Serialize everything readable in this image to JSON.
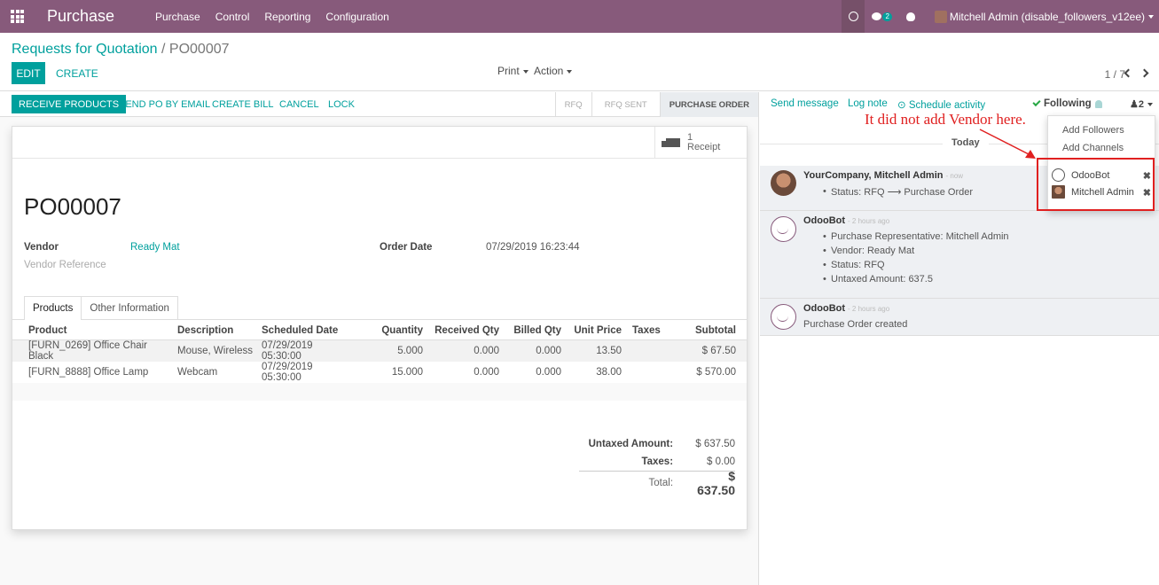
{
  "navbar": {
    "app_title": "Purchase",
    "menu": [
      "Purchase",
      "Control",
      "Reporting",
      "Configuration"
    ],
    "messages_count": "2",
    "user_name": "Mitchell Admin (disable_followers_v12ee)"
  },
  "breadcrumb": {
    "parent": "Requests for Quotation",
    "separator": "/",
    "current": "PO00007"
  },
  "control": {
    "edit": "EDIT",
    "create": "CREATE",
    "print": "Print",
    "action": "Action",
    "pager": "1 / 7"
  },
  "header_buttons": [
    "RECEIVE PRODUCTS",
    "SEND PO BY EMAIL",
    "CREATE BILL",
    "CANCEL",
    "LOCK"
  ],
  "stages": [
    "RFQ",
    "RFQ SENT",
    "PURCHASE ORDER"
  ],
  "active_stage": "PURCHASE ORDER",
  "receipt": {
    "count": "1",
    "label": "Receipt"
  },
  "form": {
    "name": "PO00007",
    "vendor_label": "Vendor",
    "vendor": "Ready Mat",
    "vendor_ref_label": "Vendor Reference",
    "order_date_label": "Order Date",
    "order_date": "07/29/2019 16:23:44"
  },
  "tabs": [
    "Products",
    "Other Information"
  ],
  "lines": {
    "columns": [
      "Product",
      "Description",
      "Scheduled Date",
      "Quantity",
      "Received Qty",
      "Billed Qty",
      "Unit Price",
      "Taxes",
      "Subtotal"
    ],
    "rows": [
      [
        "[FURN_0269] Office Chair Black",
        "Mouse, Wireless",
        "07/29/2019 05:30:00",
        "5.000",
        "0.000",
        "0.000",
        "13.50",
        "",
        "$ 67.50"
      ],
      [
        "[FURN_8888] Office Lamp",
        "Webcam",
        "07/29/2019 05:30:00",
        "15.000",
        "0.000",
        "0.000",
        "38.00",
        "",
        "$ 570.00"
      ]
    ]
  },
  "totals": {
    "untaxed_label": "Untaxed Amount:",
    "untaxed": "$ 637.50",
    "taxes_label": "Taxes:",
    "taxes": "$ 0.00",
    "total_label": "Total:",
    "total": "$ 637.50"
  },
  "chatter": {
    "send_message": "Send message",
    "log_note": "Log note",
    "schedule_activity": "Schedule activity",
    "following": "Following",
    "followers_count": "2",
    "today": "Today",
    "messages": [
      {
        "author": "YourCompany, Mitchell Admin",
        "time": "- now",
        "items": [
          "Status: RFQ ⟶ Purchase Order"
        ]
      },
      {
        "author": "OdooBot",
        "time": "- 2 hours ago",
        "items": [
          "Purchase Representative: Mitchell Admin",
          "Vendor: Ready Mat",
          "Status: RFQ",
          "Untaxed Amount: 637.5"
        ]
      },
      {
        "author": "OdooBot",
        "time": "- 2 hours ago",
        "body": "Purchase Order created"
      }
    ]
  },
  "followers_dropdown": {
    "add_followers": "Add Followers",
    "add_channels": "Add Channels",
    "followers": [
      "OdooBot",
      "Mitchell Admin"
    ]
  },
  "annotation": {
    "text": "It did not add Vendor here.",
    "color": "#e02020"
  },
  "colors": {
    "brand": "#875a7b",
    "accent": "#00a09d"
  }
}
